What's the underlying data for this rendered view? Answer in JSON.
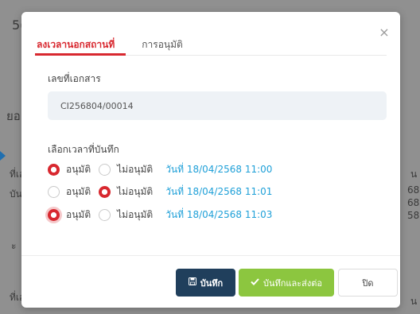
{
  "background": {
    "frag_top": "5(",
    "frag_mid": "ยอ",
    "frag_left1": "ที่เอ",
    "frag_left2": "บัน",
    "frag_left3": "ะ",
    "frag_left4": "ที่เอ",
    "frag_right1": "น",
    "frag_right2": "68",
    "frag_right3": "68",
    "frag_right4": "58",
    "frag_right5": "น"
  },
  "modal": {
    "close_icon": "×",
    "tabs": [
      {
        "label": "ลงเวลานอกสถานที่",
        "active": true
      },
      {
        "label": "การอนุมัติ",
        "active": false
      }
    ],
    "doc_label": "เลขที่เอกสาร",
    "doc_value": "CI256804/00014",
    "select_label": "เลือกเวลาที่บันทึก",
    "options": {
      "approve": "อนุมัติ",
      "reject": "ไม่อนุมัติ"
    },
    "rows": [
      {
        "approve_label": "อนุมัติ",
        "reject_label": "ไม่อนุมัติ",
        "time": "วันที่ 18/04/2568 11:00",
        "selected": "approve"
      },
      {
        "approve_label": "อนุมัติ",
        "reject_label": "ไม่อนุมัติ",
        "time": "วันที่ 18/04/2568 11:01",
        "selected": "reject"
      },
      {
        "approve_label": "อนุมัติ",
        "reject_label": "ไม่อนุมัติ",
        "time": "วันที่ 18/04/2568 11:03",
        "selected": "approve"
      }
    ],
    "buttons": {
      "save": "บันทึก",
      "save_send": "บันทึกและส่งต่อ",
      "close": "ปิด"
    }
  },
  "colors": {
    "accent_red": "#d8282f",
    "navy": "#203f5c",
    "green": "#8cc63f",
    "link_blue": "#1fa0d8"
  }
}
